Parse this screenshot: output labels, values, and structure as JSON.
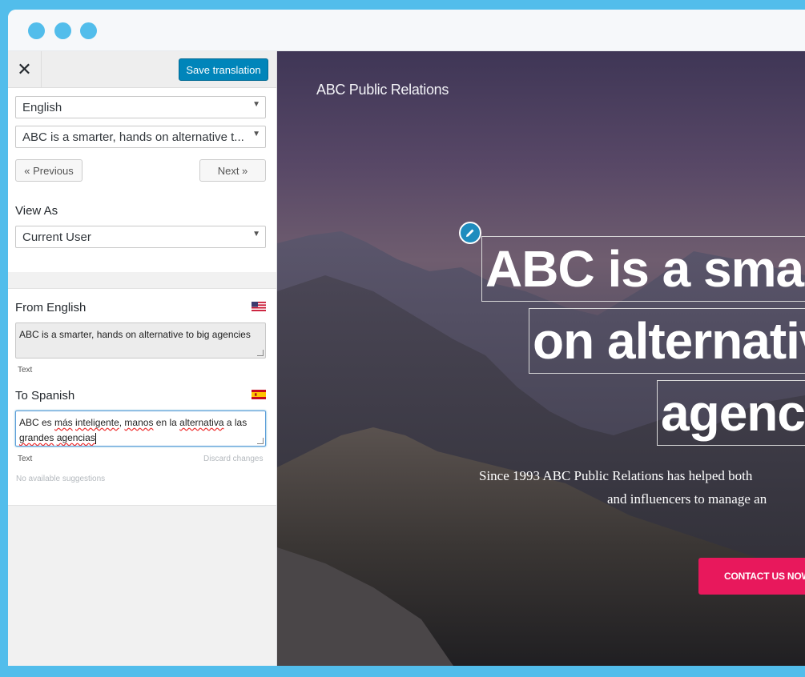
{
  "window": {
    "traffic_lights": [
      "dot",
      "dot",
      "dot"
    ],
    "accent_color": "#52bdeb"
  },
  "toolbar": {
    "close_icon": "close-icon",
    "close_glyph": "✕",
    "save_label": "Save translation",
    "save_color": "#0085ba"
  },
  "selectors": {
    "language": "English",
    "string": "ABC is a smarter, hands on alternative t...",
    "previous_label": "« Previous",
    "next_label": "Next »",
    "view_as_label": "View As",
    "view_as_value": "Current User"
  },
  "translation": {
    "from_label": "From English",
    "from_flag": "us-flag-icon",
    "from_text": "ABC is a smarter, hands on alternative to big agencies",
    "from_type": "Text",
    "to_label": "To Spanish",
    "to_flag": "spain-flag-icon",
    "to_text_parts": [
      "ABC es ",
      "más",
      " ",
      "inteligente",
      ", ",
      "manos",
      " en la ",
      "alternativa",
      " a las ",
      "grandes",
      " ",
      "agencias"
    ],
    "to_type": "Text",
    "discard_label": "Discard changes",
    "suggestions": "No available suggestions"
  },
  "preview": {
    "site_title": "ABC Public Relations",
    "headline_lines": [
      "ABC is a smar",
      "on alternativ",
      "agenci"
    ],
    "subtext_lines": [
      "Since 1993 ABC Public Relations has helped both",
      "and influencers to manage an"
    ],
    "cta_label": "CONTACT US NOW",
    "cta_color": "#e8185c",
    "edit_icon": "pencil-icon"
  }
}
